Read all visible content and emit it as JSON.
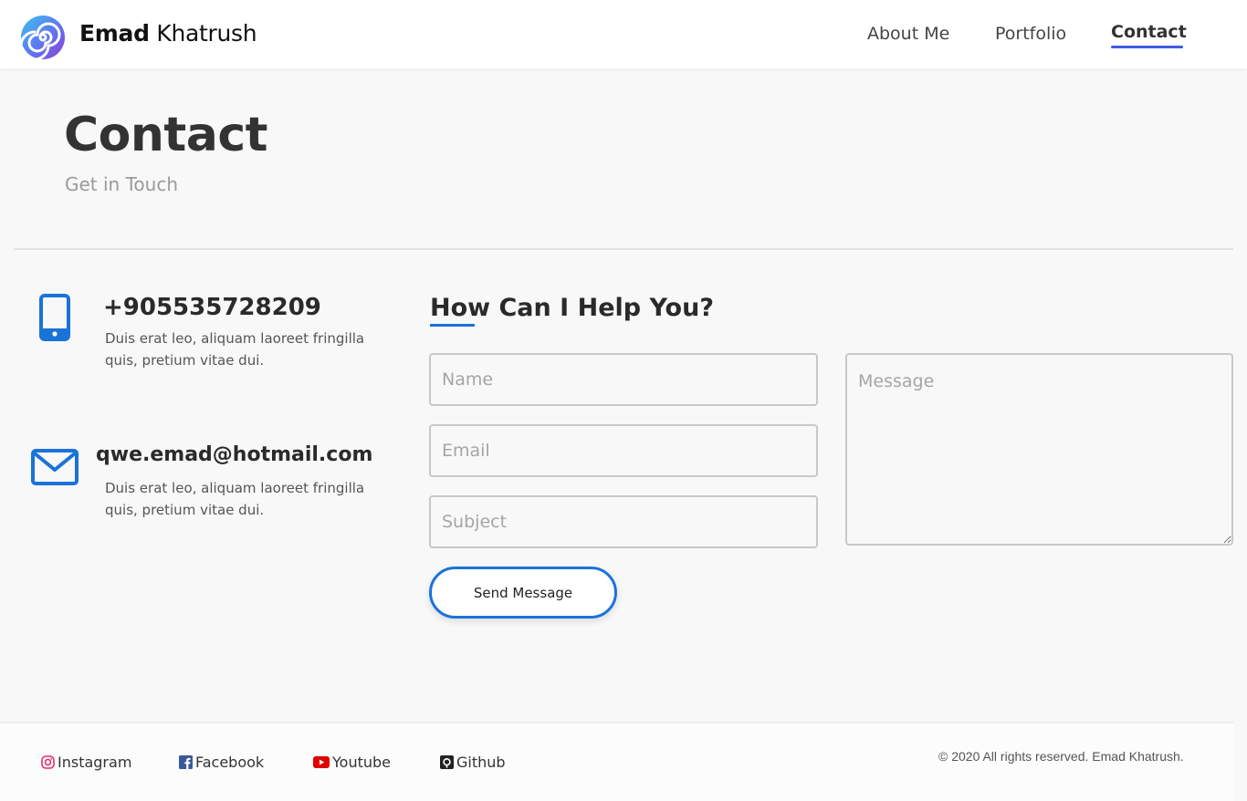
{
  "header": {
    "brand_first": "Emad",
    "brand_last": "Khatrush",
    "logo_icon": "spiral-logo-icon",
    "nav": [
      {
        "label": "About Me",
        "active": false
      },
      {
        "label": "Portfolio",
        "active": false
      },
      {
        "label": "Contact",
        "active": true
      }
    ],
    "accent_color": "#3f5ae0"
  },
  "hero": {
    "title": "Contact",
    "subtitle": "Get in Touch"
  },
  "contact_info": [
    {
      "icon": "phone-icon",
      "title": "+905535728209",
      "description": "Duis erat leo, aliquam laoreet fringilla quis, pretium vitae dui."
    },
    {
      "icon": "mail-icon",
      "title": "qwe.emad@hotmail.com",
      "description": "Duis erat leo, aliquam laoreet fringilla quis, pretium vitae dui."
    }
  ],
  "form": {
    "heading": "How Can I Help You?",
    "name_placeholder": "Name",
    "email_placeholder": "Email",
    "subject_placeholder": "Subject",
    "message_placeholder": "Message",
    "submit_label": "Send Message",
    "accent_color": "#1a73d8"
  },
  "footer": {
    "social": [
      {
        "icon": "instagram-icon",
        "label": "Instagram"
      },
      {
        "icon": "facebook-icon",
        "label": "Facebook"
      },
      {
        "icon": "youtube-icon",
        "label": "Youtube"
      },
      {
        "icon": "github-icon",
        "label": "Github"
      }
    ],
    "copyright": "© 2020 All rights reserved. Emad Khatrush."
  }
}
